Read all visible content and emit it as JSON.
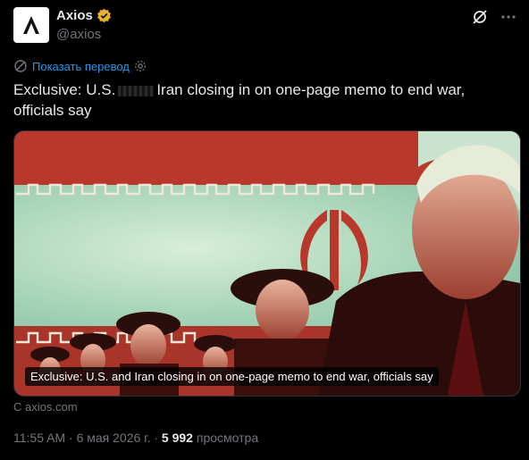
{
  "account": {
    "name": "Axios",
    "handle": "@axios",
    "avatar_icon": "axios-logo-icon",
    "verified_icon": "verified-badge-icon",
    "badge_color": "#e8b22f"
  },
  "top_icons": [
    "grok-icon",
    "more-icon"
  ],
  "translate": {
    "icon": "translate-icon",
    "label": "Показать перевод",
    "settings_icon": "gear-icon"
  },
  "tweet": {
    "text_before": "Exclusive: U.S.",
    "text_after": "Iran closing in on one-page memo to end war, officials say"
  },
  "media": {
    "caption": "Exclusive: U.S. and Iran closing in on one-page memo to end war, officials say"
  },
  "source": "С axios.com",
  "meta": {
    "time": "11:55 AM",
    "separator": " · ",
    "date": "6 мая 2026 г.",
    "views_count": "5 992",
    "views_label": "просмотра"
  },
  "colors": {
    "accent": "#1d9bf0",
    "muted": "#71767b",
    "flag_red": "#b5372a",
    "flag_green": "#b9dcc4"
  }
}
